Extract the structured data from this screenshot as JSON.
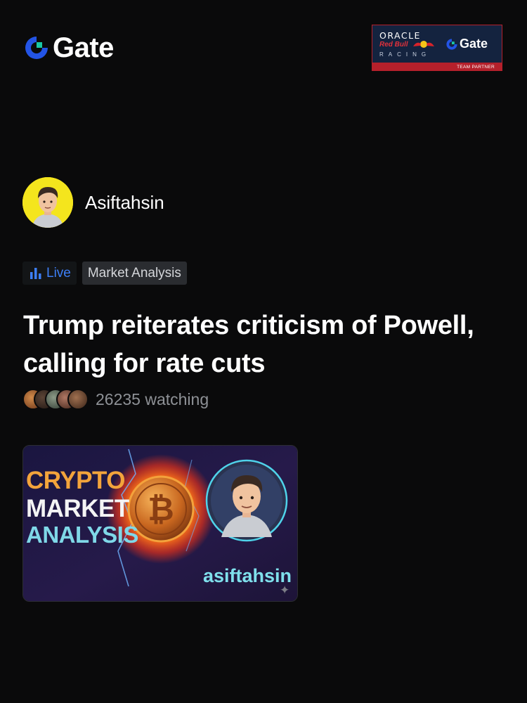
{
  "brand": {
    "name": "Gate",
    "accent": "#2354e6",
    "accent2": "#19c8a5"
  },
  "partner": {
    "line1": "ORACLE",
    "line2": "Red Bull",
    "line3": "RACING",
    "brand": "Gate",
    "band": "TEAM PARTNER"
  },
  "author": {
    "name": "Asiftahsin"
  },
  "tags": {
    "live": "Live",
    "category": "Market Analysis"
  },
  "post": {
    "title": "Trump reiterates criticism of Powell, calling for rate cuts"
  },
  "watching": {
    "text": "26235 watching",
    "avatar_colors": [
      "#b86a32",
      "#3b2b22",
      "#5d6a5a",
      "#7a4c3c",
      "#5a3a2a"
    ]
  },
  "thumbnail": {
    "line1": "CRYPTO",
    "line2": "MARKET",
    "line3": "ANALYSIS",
    "handle": "asiftahsin",
    "coin_symbol": "₿"
  },
  "colors": {
    "background": "#0a0a0b",
    "live": "#3d7ff7",
    "muted": "#8e9196"
  }
}
